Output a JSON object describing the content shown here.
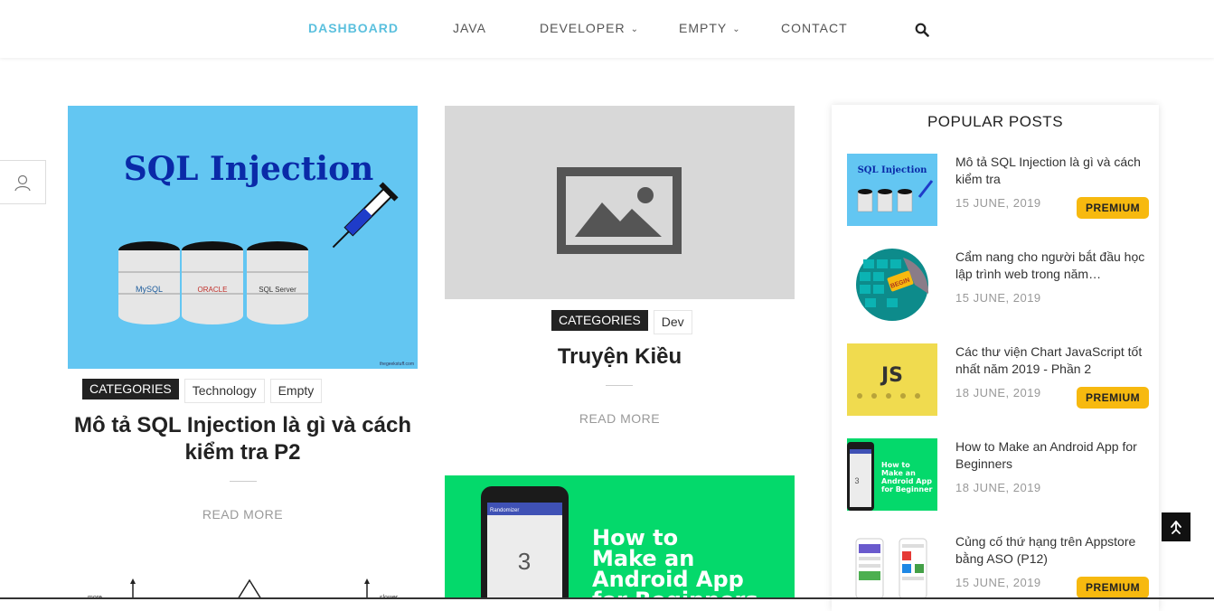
{
  "nav": {
    "items": [
      {
        "label": "DASHBOARD",
        "active": true
      },
      {
        "label": "JAVA"
      },
      {
        "label": "DEVELOPER",
        "dropdown": true
      },
      {
        "label": "EMPTY",
        "dropdown": true
      },
      {
        "label": "CONTACT"
      }
    ],
    "search_icon": "search-icon"
  },
  "posts": [
    {
      "image_heading": "SQL Injection",
      "image_db_labels": [
        "MySQL",
        "ORACLE",
        "SQL Server"
      ],
      "image_watermark": "thegeekstuff.com",
      "categories_label": "CATEGORIES",
      "tags": [
        "Technology",
        "Empty"
      ],
      "title_line1": "Mô tả SQL Injection là gì và cách",
      "title_line2": "kiểm tra P2",
      "read_more": "READ MORE",
      "graph_labels": [
        "more",
        "slower"
      ]
    },
    {
      "image": "placeholder-image-icon",
      "categories_label": "CATEGORIES",
      "tags": [
        "Dev"
      ],
      "title": "Truyện Kiều",
      "read_more": "READ MORE"
    },
    {
      "image_text": [
        "How to",
        "Make an",
        "Android App",
        "for Beginners"
      ],
      "phone_app_bar": "Randomizer",
      "phone_number": "3"
    }
  ],
  "sidebar": {
    "title": "POPULAR POSTS",
    "items": [
      {
        "title": "Mô tả SQL Injection là gì và cách kiểm tra",
        "date": "15 JUNE, 2019",
        "premium": "PREMIUM",
        "thumb_text": "SQL Injection"
      },
      {
        "title": "Cẩm nang cho người bắt đầu học lập trình web trong năm…",
        "date": "15 JUNE, 2019",
        "thumb_text": "BEGIN"
      },
      {
        "title": "Các thư viện Chart JavaScript tốt nhất năm 2019 - Phần 2",
        "date": "18 JUNE, 2019",
        "premium": "PREMIUM",
        "thumb_text": "JS"
      },
      {
        "title": "How to Make an Android App for Beginners",
        "date": "18 JUNE, 2019",
        "thumb_text": [
          "How to",
          "Make an",
          "Android App",
          "for Beginner"
        ],
        "thumb_number": "3"
      },
      {
        "title": "Củng cố thứ hạng trên Appstore bằng ASO (P12)",
        "date": "15 JUNE, 2019",
        "premium": "PREMIUM"
      }
    ]
  },
  "colors": {
    "accent": "#5bc0de",
    "premium": "#f7b90f",
    "sql_bg": "#63c6f2",
    "android_bg": "#04d96b",
    "js_bg": "#f0db4f"
  }
}
